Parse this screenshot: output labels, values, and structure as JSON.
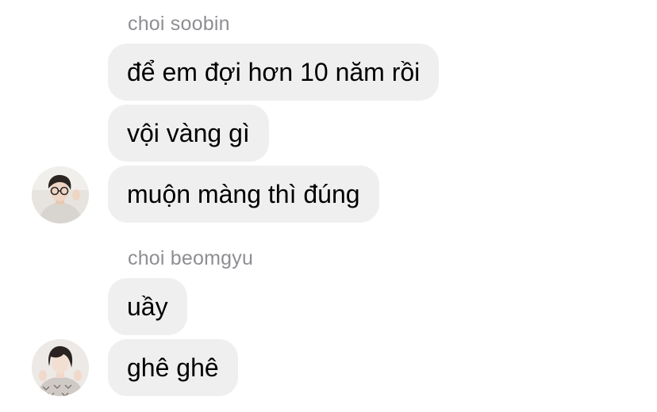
{
  "conversation": {
    "groups": [
      {
        "sender": "choi soobin",
        "messages": [
          "để em đợi hơn 10 năm rồi",
          "vội vàng gì",
          "muộn màng thì đúng"
        ]
      },
      {
        "sender": "choi beomgyu",
        "messages": [
          "uầy",
          "ghê ghê"
        ]
      }
    ]
  },
  "colors": {
    "bubble_bg": "#efefef",
    "sender_text": "#8e8e93",
    "message_text": "#000000",
    "background": "#ffffff"
  },
  "icons": {
    "avatar_1": "avatar-soobin",
    "avatar_2": "avatar-beomgyu"
  }
}
